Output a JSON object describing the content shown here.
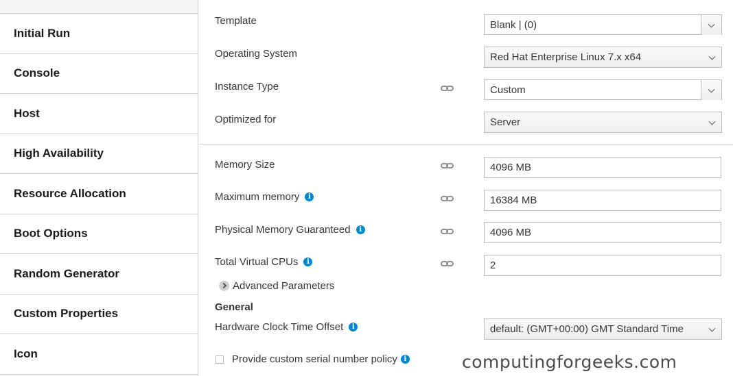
{
  "sidebar": {
    "items": [
      {
        "label": "Initial Run"
      },
      {
        "label": "Console"
      },
      {
        "label": "Host"
      },
      {
        "label": "High Availability"
      },
      {
        "label": "Resource Allocation"
      },
      {
        "label": "Boot Options"
      },
      {
        "label": "Random Generator"
      },
      {
        "label": "Custom Properties"
      },
      {
        "label": "Icon"
      }
    ]
  },
  "form": {
    "template": {
      "label": "Template",
      "value": "Blank |  (0)"
    },
    "os": {
      "label": "Operating System",
      "value": "Red Hat Enterprise Linux 7.x x64"
    },
    "instance_type": {
      "label": "Instance Type",
      "value": "Custom"
    },
    "optimized_for": {
      "label": "Optimized for",
      "value": "Server"
    },
    "memory_size": {
      "label": "Memory Size",
      "value": "4096 MB"
    },
    "max_memory": {
      "label": "Maximum memory",
      "value": "16384 MB"
    },
    "phys_memory": {
      "label": "Physical Memory Guaranteed",
      "value": "4096 MB"
    },
    "vcpus": {
      "label": "Total Virtual CPUs",
      "value": "2"
    },
    "advanced": {
      "label": "Advanced Parameters"
    },
    "general": {
      "title": "General"
    },
    "clock_offset": {
      "label": "Hardware Clock Time Offset",
      "value": "default: (GMT+00:00) GMT Standard Time"
    },
    "serial_policy": {
      "label": "Provide custom serial number policy",
      "checked": false
    }
  },
  "watermark": "computingforgeeks.com",
  "icons": {
    "info": "info-icon",
    "link": "link-icon",
    "chevron": "chevron-down-icon",
    "expand": "chevron-right-icon"
  },
  "colors": {
    "info": "#0088ce",
    "border": "#bbbbbb",
    "text": "#363636"
  }
}
